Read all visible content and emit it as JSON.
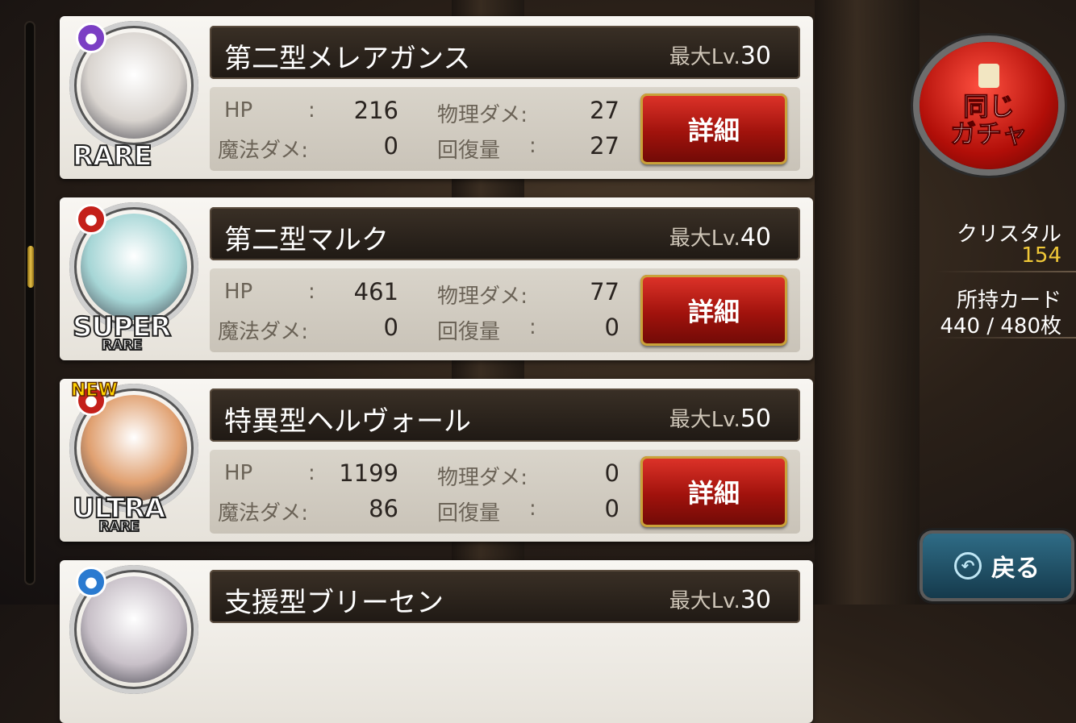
{
  "cards": [
    {
      "name": "第二型メレアガンス",
      "lv_label": "最大Lv.",
      "lv": "30",
      "rarity": "RARE",
      "rarity_sub": "",
      "new": "",
      "element": "swirl-icon",
      "element_color": "#7b3fc4",
      "face_color": "#d9d4cf",
      "hp_label": "HP",
      "hp": "216",
      "phys_label": "物理ダメ:",
      "phys": "27",
      "mag_label": "魔法ダメ:",
      "mag": "0",
      "heal_label": "回復量",
      "heal": "27",
      "detail": "詳細"
    },
    {
      "name": "第二型マルク",
      "lv_label": "最大Lv.",
      "lv": "40",
      "rarity": "SUPER",
      "rarity_sub": "RARE",
      "new": "",
      "element": "shield-icon",
      "element_color": "#c4201a",
      "face_color": "#a6d6d6",
      "hp_label": "HP",
      "hp": "461",
      "phys_label": "物理ダメ:",
      "phys": "77",
      "mag_label": "魔法ダメ:",
      "mag": "0",
      "heal_label": "回復量",
      "heal": "0",
      "detail": "詳細"
    },
    {
      "name": "特異型ヘルヴォール",
      "lv_label": "最大Lv.",
      "lv": "50",
      "rarity": "ULTRA",
      "rarity_sub": "RARE",
      "new": "NEW",
      "element": "crossed-swords-icon",
      "element_color": "#c4201a",
      "face_color": "#e0a070",
      "hp_label": "HP",
      "hp": "1199",
      "phys_label": "物理ダメ:",
      "phys": "0",
      "mag_label": "魔法ダメ:",
      "mag": "86",
      "heal_label": "回復量",
      "heal": "0",
      "detail": "詳細"
    },
    {
      "name": "支援型ブリーセン",
      "lv_label": "最大Lv.",
      "lv": "30",
      "rarity": "",
      "rarity_sub": "",
      "new": "",
      "element": "swirl-icon",
      "element_color": "#2a7ad0",
      "face_color": "#c8c0c8",
      "hp_label": "",
      "hp": "",
      "phys_label": "",
      "phys": "",
      "mag_label": "",
      "mag": "",
      "heal_label": "",
      "heal": "",
      "detail": ""
    }
  ],
  "colon": ":",
  "gacha": {
    "line1": "同じ",
    "line2": "ガチャ"
  },
  "crystal": {
    "label": "クリスタル",
    "value": "154",
    "color": "#f0c838"
  },
  "cards_owned": {
    "label": "所持カード",
    "value": "440 / 480枚"
  },
  "back": {
    "label": "戻る"
  },
  "scroll": {
    "position": 0.43
  }
}
